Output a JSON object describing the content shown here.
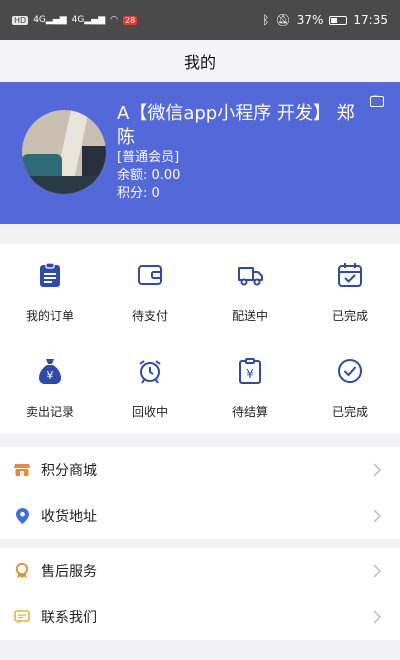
{
  "status_bar": {
    "carrier_badge": "HD",
    "signal_1": "4G",
    "signal_2": "4G",
    "notification_badge": "28",
    "battery_percent": "37%",
    "time": "17:35"
  },
  "header": {
    "title": "我的"
  },
  "profile": {
    "name": "A【微信app小程序 开发】 郑陈",
    "level": "[普通会员]",
    "balance": "余额: 0.00",
    "points": "积分: 0"
  },
  "orders": {
    "items": [
      {
        "label": "我的订单",
        "icon": "clipboard-icon"
      },
      {
        "label": "待支付",
        "icon": "wallet-icon"
      },
      {
        "label": "配送中",
        "icon": "truck-icon"
      },
      {
        "label": "已完成",
        "icon": "calendar-check-icon"
      }
    ]
  },
  "recycle": {
    "items": [
      {
        "label": "卖出记录",
        "icon": "money-bag-icon"
      },
      {
        "label": "回收中",
        "icon": "alarm-clock-icon"
      },
      {
        "label": "待结算",
        "icon": "receipt-icon"
      },
      {
        "label": "已完成",
        "icon": "check-circle-icon"
      }
    ]
  },
  "menu_group_1": [
    {
      "label": "积分商城",
      "icon": "shop-icon"
    },
    {
      "label": "收货地址",
      "icon": "location-pin-icon"
    }
  ],
  "menu_group_2": [
    {
      "label": "售后服务",
      "icon": "service-badge-icon"
    },
    {
      "label": "联系我们",
      "icon": "chat-icon"
    }
  ],
  "colors": {
    "accent": "#5469d9",
    "icon_blue": "#2f4aa8",
    "shop_orange": "#e8883a",
    "location_blue": "#3f6fd8",
    "service_orange": "#d8963a",
    "chat_yellow": "#e5b23a"
  }
}
